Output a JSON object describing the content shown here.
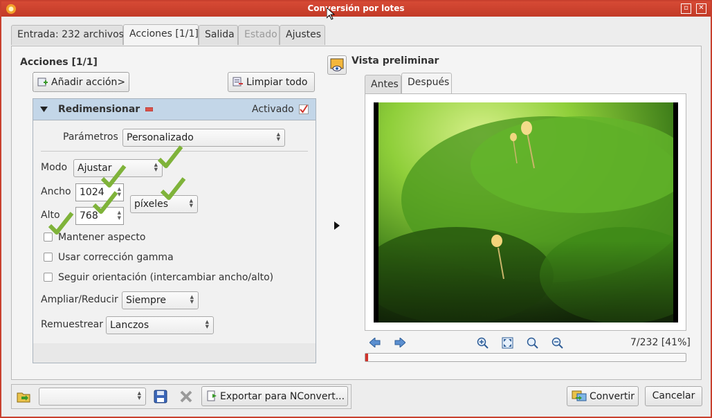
{
  "window": {
    "title": "Conversión por lotes"
  },
  "tabs": [
    {
      "label": "Entrada: 232 archivos",
      "state": "normal"
    },
    {
      "label": "Acciones [1/1]",
      "state": "active"
    },
    {
      "label": "Salida",
      "state": "normal"
    },
    {
      "label": "Estado",
      "state": "disabled"
    },
    {
      "label": "Ajustes",
      "state": "normal"
    }
  ],
  "actions": {
    "title": "Acciones [1/1]",
    "add_action_label": "Añadir acción>",
    "clear_all_label": "Limpiar todo"
  },
  "resize": {
    "title": "Redimensionar",
    "enabled_label": "Activado",
    "enabled": true,
    "params_label": "Parámetros",
    "params_value": "Personalizado",
    "mode_label": "Modo",
    "mode_value": "Ajustar",
    "width_label": "Ancho",
    "width_value": "1024",
    "height_label": "Alto",
    "height_value": "768",
    "unit_value": "píxeles",
    "keep_aspect_label": "Mantener aspecto",
    "gamma_label": "Usar corrección gamma",
    "orientation_label": "Seguir orientación (intercambiar ancho/alto)",
    "enlarge_label": "Ampliar/Reducir",
    "enlarge_value": "Siempre",
    "resample_label": "Remuestrear",
    "resample_value": "Lanczos"
  },
  "preview": {
    "title": "Vista preliminar",
    "tab_before": "Antes",
    "tab_after": "Después",
    "counter": "7/232 [41%]",
    "progress_fraction": 0.0
  },
  "bottom": {
    "export_label": "Exportar para NConvert...",
    "convert_label": "Convertir",
    "cancel_label": "Cancelar"
  },
  "colors": {
    "accent": "#c23a27",
    "panel_header": "#c3d6e8",
    "check_red": "#d0342c",
    "tick_green": "#7fb33a"
  }
}
